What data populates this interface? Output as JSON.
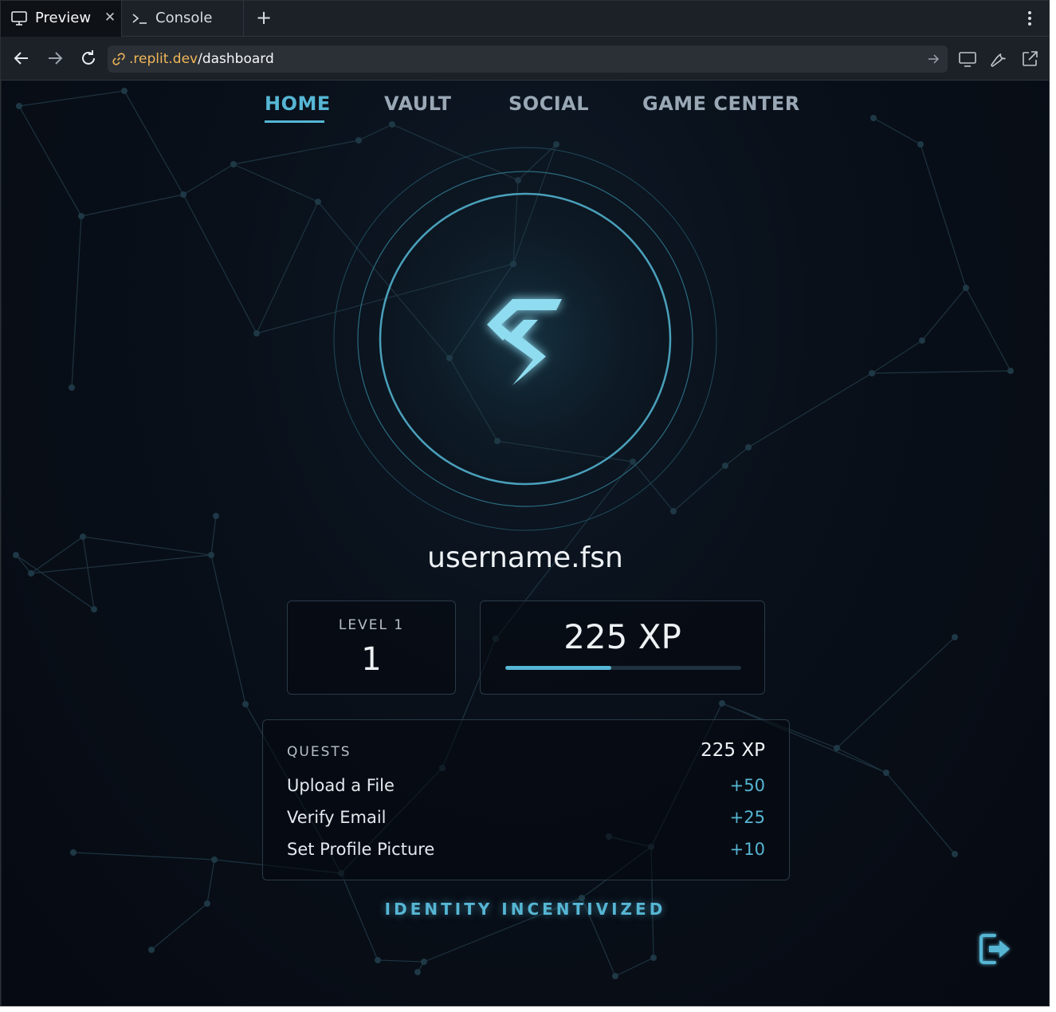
{
  "browser": {
    "tabs": [
      {
        "label": "Preview",
        "icon": "monitor-icon",
        "active": true
      },
      {
        "label": "Console",
        "icon": "terminal-icon",
        "active": false
      }
    ],
    "url": {
      "host": ".replit.dev",
      "path": "/dashboard"
    }
  },
  "app": {
    "nav": [
      {
        "label": "HOME",
        "active": true
      },
      {
        "label": "VAULT",
        "active": false
      },
      {
        "label": "SOCIAL",
        "active": false
      },
      {
        "label": "GAME CENTER",
        "active": false
      }
    ],
    "logo_icon": "chevron-s-logo-icon",
    "username": "username.fsn",
    "level": {
      "label": "LEVEL 1",
      "value": "1"
    },
    "xp": {
      "value": "225 XP",
      "progress_fraction": 0.45
    },
    "quests": {
      "title": "QUESTS",
      "total": "225 XP",
      "items": [
        {
          "name": "Upload a File",
          "xp": "+50"
        },
        {
          "name": "Verify Email",
          "xp": "+25"
        },
        {
          "name": "Set Profile Picture",
          "xp": "+10"
        }
      ]
    },
    "tagline": "IDENTITY INCENTIVIZED",
    "logout_icon": "logout-icon"
  },
  "colors": {
    "accent": "#56b6d4",
    "background": "#060a12",
    "url_host": "#f0b658"
  }
}
